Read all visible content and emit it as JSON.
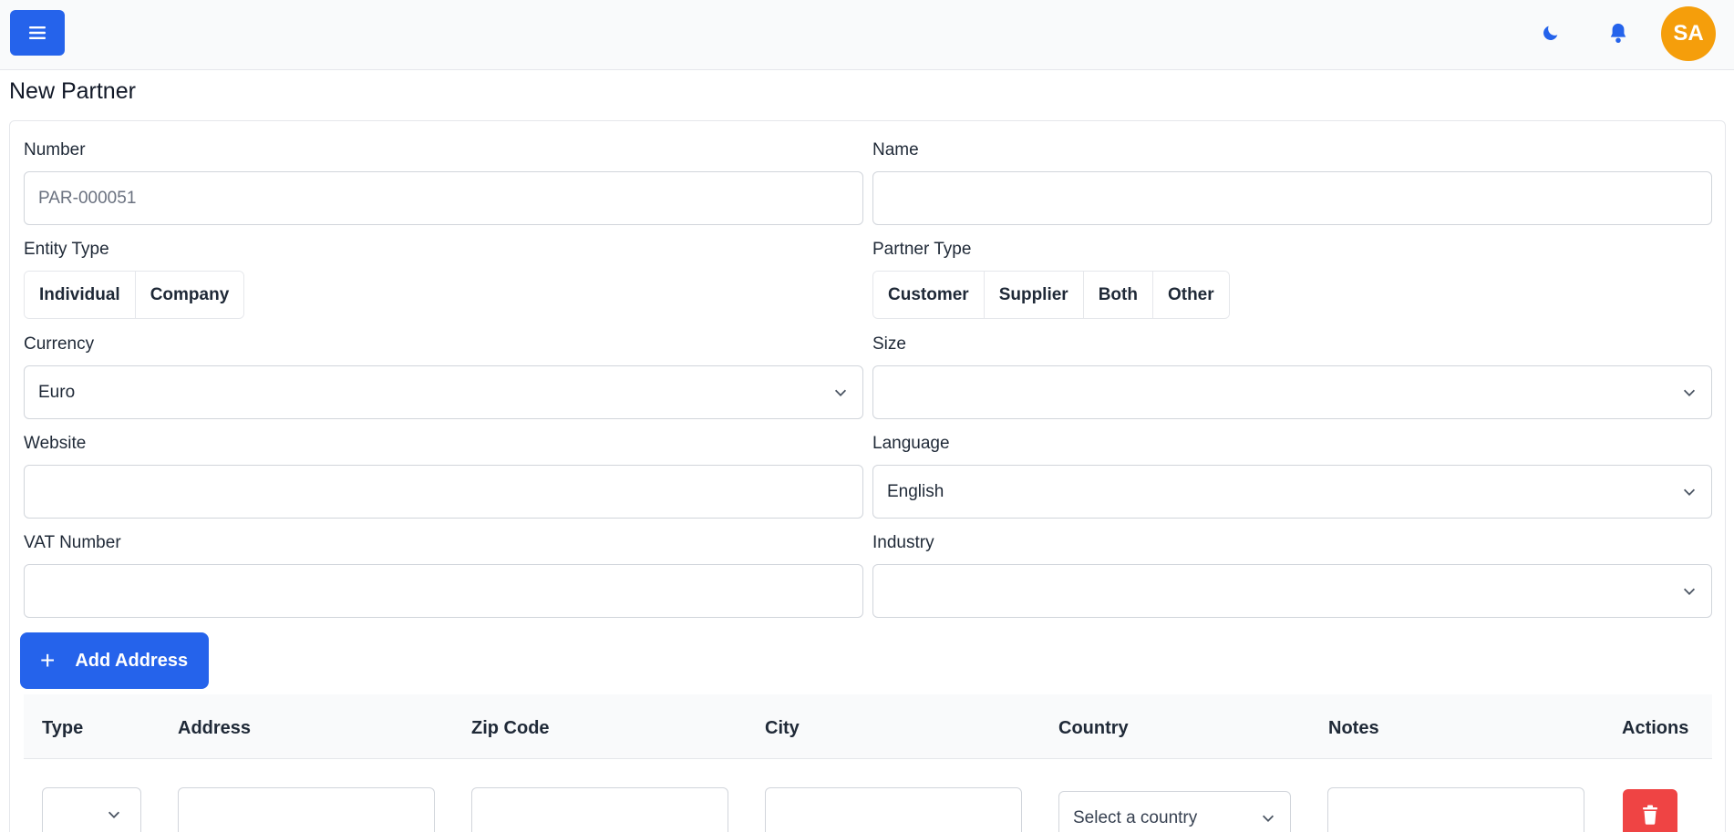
{
  "header": {
    "menu_icon": "hamburger-icon",
    "theme_icon": "moon-icon",
    "notify_icon": "bell-icon",
    "avatar_initials": "SA",
    "accent": "#2563eb",
    "avatar_color": "#f59e0b"
  },
  "page": {
    "title": "New Partner"
  },
  "form": {
    "number": {
      "label": "Number",
      "placeholder": "PAR-000051",
      "value": ""
    },
    "name": {
      "label": "Name",
      "value": ""
    },
    "entity_type": {
      "label": "Entity Type",
      "options": [
        "Individual",
        "Company"
      ]
    },
    "partner_type": {
      "label": "Partner Type",
      "options": [
        "Customer",
        "Supplier",
        "Both",
        "Other"
      ]
    },
    "currency": {
      "label": "Currency",
      "value": "Euro"
    },
    "size": {
      "label": "Size",
      "value": ""
    },
    "website": {
      "label": "Website",
      "value": ""
    },
    "language": {
      "label": "Language",
      "value": "English"
    },
    "vat": {
      "label": "VAT Number",
      "value": ""
    },
    "industry": {
      "label": "Industry",
      "value": ""
    }
  },
  "addresses": {
    "add_label": "Add Address",
    "columns": [
      "Type",
      "Address",
      "Zip Code",
      "City",
      "Country",
      "Notes",
      "Actions"
    ],
    "row": {
      "country_placeholder": "Select a country",
      "delete_icon": "trash-icon",
      "delete_color": "#ef4444"
    }
  }
}
